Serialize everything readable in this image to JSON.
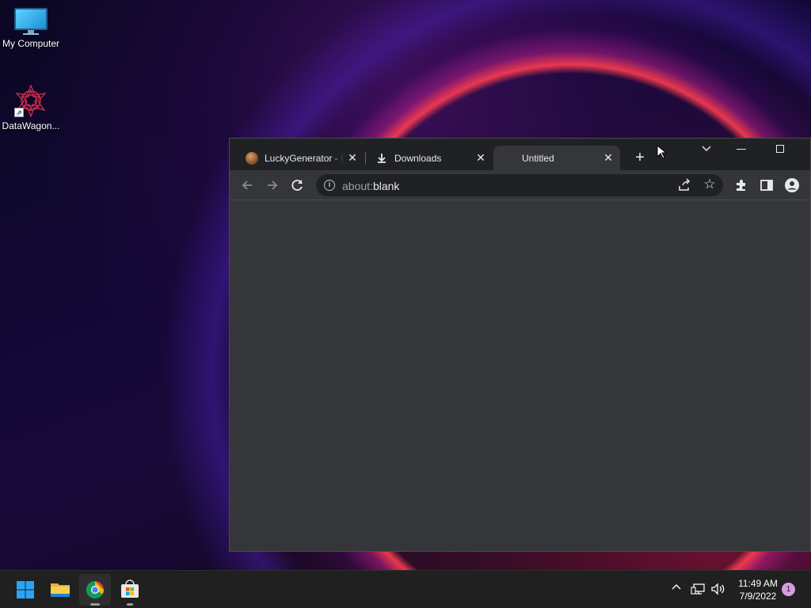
{
  "desktop": {
    "icons": [
      {
        "label": "My Computer",
        "icon": "computer-icon"
      },
      {
        "label": "DataWagon...",
        "icon": "datawagon-icon"
      }
    ]
  },
  "browser": {
    "tabs": [
      {
        "title": "LuckyGenerator - I",
        "icon": "site-favicon",
        "close": "✕"
      },
      {
        "title": "Downloads",
        "icon": "download-icon",
        "close": "✕"
      },
      {
        "title": "Untitled",
        "close": "✕",
        "active": true
      }
    ],
    "new_tab": "+",
    "address": {
      "scheme": "about:",
      "host": "blank"
    },
    "colors": {
      "frame": "#202124",
      "toolbar": "#35363a",
      "omnibox": "#202124",
      "text": "#e8eaed"
    }
  },
  "taskbar": {
    "apps": [
      "start-icon",
      "file-explorer-icon",
      "chrome-icon",
      "store-icon"
    ],
    "clock": {
      "time": "11:49 AM",
      "date": "7/9/2022"
    },
    "notifications": "1",
    "tray_chevron": "^"
  }
}
